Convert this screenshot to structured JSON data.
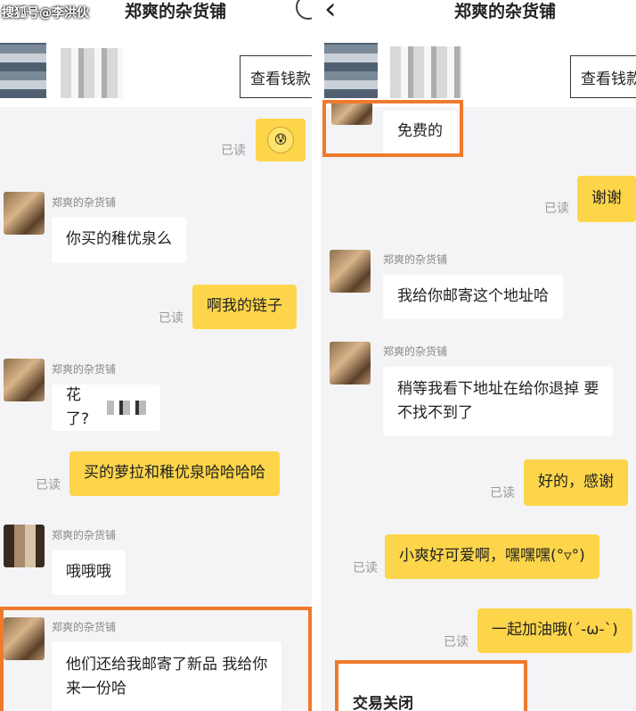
{
  "watermark": "搜狐号@李洪伙",
  "left": {
    "title": "郑爽的杂货铺",
    "check_button": "查看钱款",
    "messages": {
      "read": "已读",
      "sender": "郑爽的杂货铺",
      "m1": "你买的稚优泉么",
      "m2": "啊我的链子",
      "m3": "花了?",
      "m4": "买的萝拉和稚优泉哈哈哈哈",
      "m5": "哦哦哦",
      "m6a": "他们还给我邮寄了新品 我给你",
      "m6b": "来一份哈"
    }
  },
  "right": {
    "title": "郑爽的杂货铺",
    "back_icon": "‹",
    "check_button": "查看钱款",
    "messages": {
      "read": "已读",
      "sender": "郑爽的杂货铺",
      "m1": "免费的",
      "m2": "谢谢",
      "m3": "我给你邮寄这个地址哈",
      "m4a": "稍等我看下地址在给你退掉 要",
      "m4b": "不找不到了",
      "m5": "好的，感谢",
      "m6": "小爽好可爱啊，嘿嘿嘿(°▿°)",
      "m7": "一起加油哦(´-ω-`)",
      "status": "交易关闭"
    }
  },
  "colors": {
    "accent": "#fcd54a",
    "highlight": "#f07a2c",
    "bg": "#f4f4f6"
  }
}
